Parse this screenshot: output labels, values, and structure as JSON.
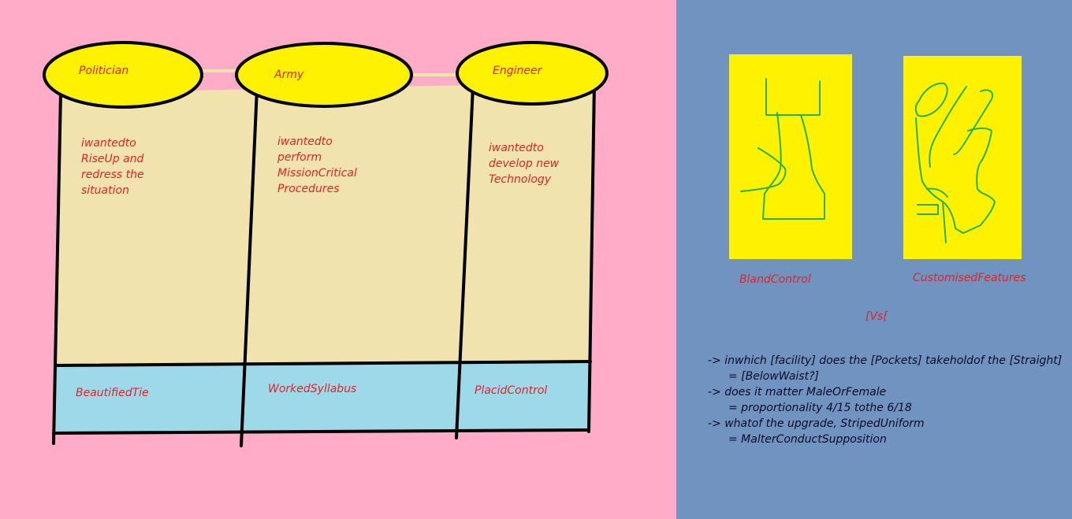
{
  "columns": [
    {
      "title": "Politician",
      "description": "iwantedto\nRiseUp and\nredress the\nsituation",
      "footer": "BeautifiedTie"
    },
    {
      "title": "Army",
      "description": "iwantedto\nperform\nMissionCritical\nProcedures",
      "footer": "WorkedSyllabus"
    },
    {
      "title": "Engineer",
      "description": "iwantedto\ndevelop new\nTechnology",
      "footer": "PlacidControl"
    }
  ],
  "comparison": {
    "left_label": "BlandControl",
    "right_label": "CustomisedFeatures",
    "versus": "[Vs["
  },
  "notes": [
    {
      "question": "-> inwhich [facility] does the [Pockets] takeholdof the [Straight]",
      "answer": "= [BelowWaist?]"
    },
    {
      "question": "-> does it matter MaleOrFemale",
      "answer": "= proportionality 4/15 tothe 6/18"
    },
    {
      "question": "-> whatof the upgrade, StripedUniform",
      "answer": "= MalterConductSupposition"
    }
  ],
  "colors": {
    "left_background": "#FFACC8",
    "right_background": "#7093BF",
    "column_fill": "#F0E3AD",
    "footer_fill": "#9DD9E8",
    "ellipse_fill": "#FFF200",
    "panel_fill": "#FFF200",
    "sketch_stroke": "#22B14C",
    "label_text": "#E0232B"
  }
}
